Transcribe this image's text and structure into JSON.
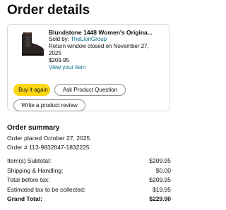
{
  "page": {
    "title": "Order details"
  },
  "item": {
    "title": "Blundstone 1448 Women's Origina...",
    "sold_by_label": "Sold by: ",
    "seller": "TheLionGroup",
    "return_line1": "Return window closed on November 27,",
    "return_line2": "2025",
    "price": "$209.95",
    "view_item": "View your item"
  },
  "buttons": {
    "buy_again": "Buy it again",
    "ask_question": "Ask Product Question",
    "write_review": "Write a product review"
  },
  "summary": {
    "title": "Order summary",
    "placed": "Order placed October 27, 2025",
    "order_number": "Order # 113-9832047-1832225",
    "rows": [
      {
        "label": "Item(s) Subtotal:",
        "value": "$209.95"
      },
      {
        "label": "Shipping & Handling:",
        "value": "$0.00"
      },
      {
        "label": "Total before tax:",
        "value": "$209.95"
      },
      {
        "label": "Estimated tax to be collected:",
        "value": "$19.95"
      },
      {
        "label": "Grand Total:",
        "value": "$229.90"
      }
    ]
  },
  "colors": {
    "primary_button": "#ffd814",
    "link": "#007185"
  },
  "icons": {
    "product": "boot-thumbnail"
  }
}
